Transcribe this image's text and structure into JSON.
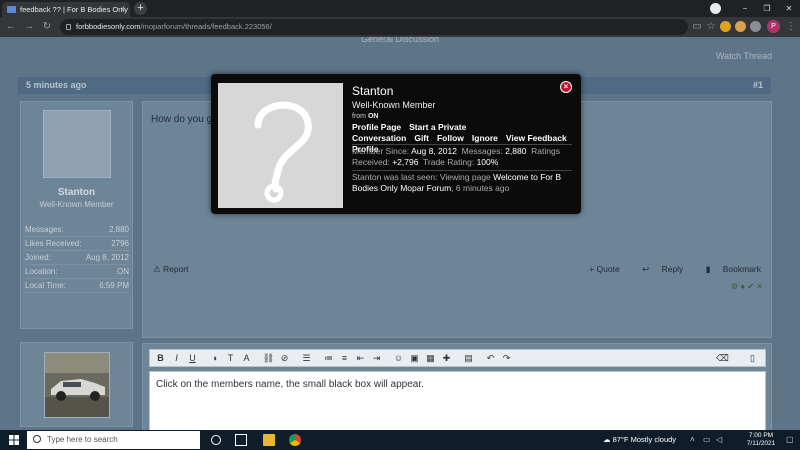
{
  "browser": {
    "tab_title": "feedback ?? | For B Bodies Only C",
    "tab_close": "×",
    "new_tab": "+",
    "url_domain": "forbbodiesonly.com",
    "url_path": "/moparforum/threads/feedback.223056/",
    "profile_initial": "P",
    "minimize": "−",
    "maximize": "❐",
    "close": "✕"
  },
  "page": {
    "breadcrumb": "General Discussion",
    "watch_thread": "Watch Thread",
    "post_time": "5 minutes ago",
    "post_number": "#1",
    "post_text": "How do you g",
    "report": "Report",
    "quote": "+ Quote",
    "reply": "Reply",
    "bookmark": "Bookmark"
  },
  "user": {
    "name": "Stanton",
    "title": "Well-Known Member",
    "stats": [
      {
        "label": "Messages:",
        "value": "2,880"
      },
      {
        "label": "Likes Received:",
        "value": "2796"
      },
      {
        "label": "Joined:",
        "value": "Aug 8, 2012"
      },
      {
        "label": "Location:",
        "value": "ON"
      },
      {
        "label": "Local Time:",
        "value": "6:59 PM"
      }
    ]
  },
  "editor": {
    "content": "Click on the members name, the small black box will appear."
  },
  "tooltip": {
    "name": "Stanton",
    "title": "Well-Known Member",
    "from_label": "from",
    "from_value": "ON",
    "links": [
      "Profile Page",
      "Start a Private Conversation",
      "Gift",
      "Follow",
      "Ignore",
      "View Feedback Profile"
    ],
    "member_since_label": "Member Since:",
    "member_since": "Aug 8, 2012",
    "messages_label": "Messages:",
    "messages": "2,880",
    "ratings_label": "Ratings Received:",
    "ratings": "+2,796",
    "trade_label": "Trade Rating:",
    "trade": "100%",
    "last_seen_prefix": "Stanton was last seen: Viewing page",
    "last_seen_page": "Welcome to For B Bodies Only Mopar Forum",
    "last_seen_time": ", 6 minutes ago",
    "close": "×"
  },
  "taskbar": {
    "search_placeholder": "Type here to search",
    "weather": "87°F  Mostly cloudy",
    "time": "7:00 PM",
    "date": "7/11/2021"
  },
  "colors": {
    "page_bg": "#5e7488",
    "panel_bg": "#6e8497",
    "tooltip_bg": "#0b0b0b",
    "close_red": "#c8102e",
    "taskbar_bg": "#0f1d2b"
  }
}
